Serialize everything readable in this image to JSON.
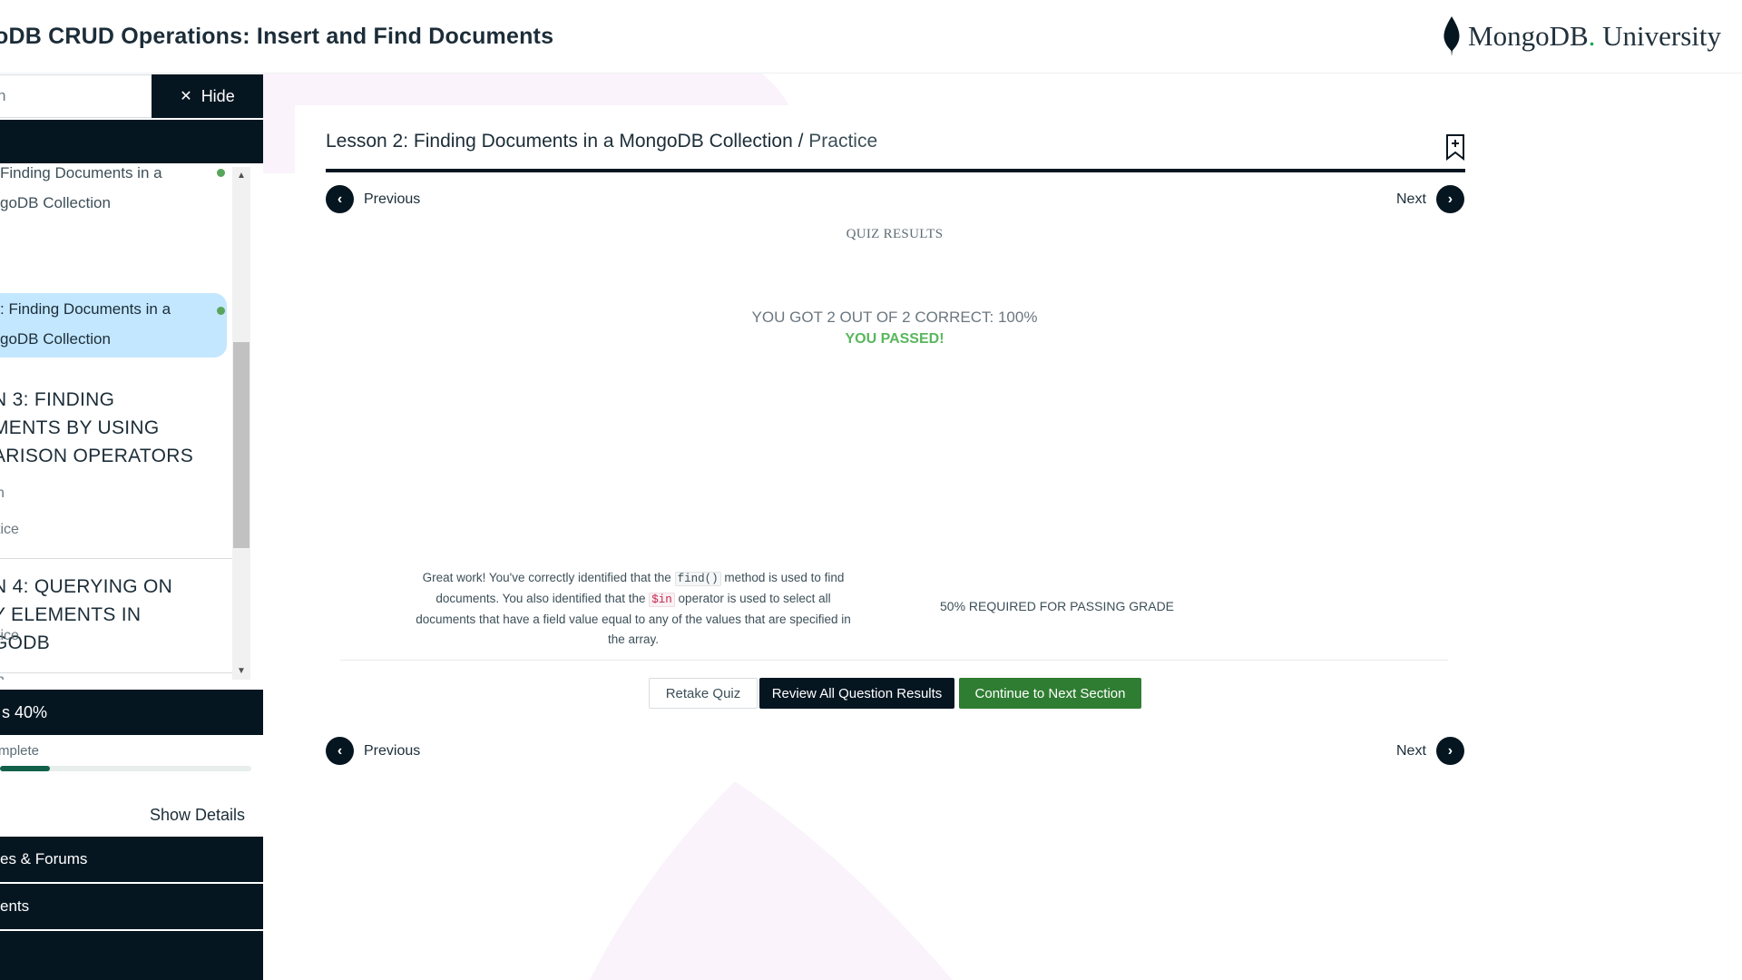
{
  "header": {
    "course_title": "oDB CRUD Operations: Insert and Find Documents",
    "logo_text": "MongoDB",
    "logo_dot": ".",
    "logo_suffix": " University"
  },
  "sidebar": {
    "search_placeholder": "h",
    "hide_label": "Hide",
    "items": [
      {
        "label": "Finding Documents in a MongoDB Collection",
        "line1": "Finding Documents in a",
        "line2": "goDB Collection"
      },
      {
        "label_line1": ": Finding Documents in a",
        "label_line2": "goDB Collection"
      }
    ],
    "section3": {
      "line1": "N 3: FINDING",
      "line2": "MENTS BY USING",
      "line3": "ARISON OPERATORS",
      "sub1": "n",
      "sub2": "tice"
    },
    "section4": {
      "line1": "N 4: QUERYING ON",
      "line2": "Y ELEMENTS IN",
      "line3": "GODB",
      "sub1": "n",
      "sub2": "tice"
    },
    "progress_text": "s 40%",
    "complete_label": "mplete",
    "progress_value": 0.2,
    "show_details": "Show Details",
    "nav_links": [
      "es & Forums",
      "ents",
      ""
    ]
  },
  "main": {
    "lesson_title": "Lesson 2: Finding Documents in a MongoDB Collection",
    "separator": " / ",
    "lesson_subtitle": "Practice",
    "previous_label": "Previous",
    "next_label": "Next",
    "quiz_results": "QUIZ RESULTS",
    "score_text": "YOU GOT 2 OUT OF 2 CORRECT: 100%",
    "passed_text": "YOU PASSED!",
    "feedback_part1": "Great work! You've correctly identified that the ",
    "feedback_code1": "find()",
    "feedback_part2": " method is used to find documents. You also identified that the ",
    "feedback_code2": "$in",
    "feedback_part3": " operator is used to select all documents that have a field value equal to any of the values that are specified in the array.",
    "required_text": "50% REQUIRED FOR PASSING GRADE",
    "retake_label": "Retake Quiz",
    "review_label": "Review All Question Results",
    "continue_label": "Continue to Next Section"
  },
  "colors": {
    "dark_navy": "#061621",
    "active_item": "#c3e7fe",
    "pass_green": "#59b75d",
    "continue_green": "#2f7d32",
    "progress_green": "#116149"
  }
}
